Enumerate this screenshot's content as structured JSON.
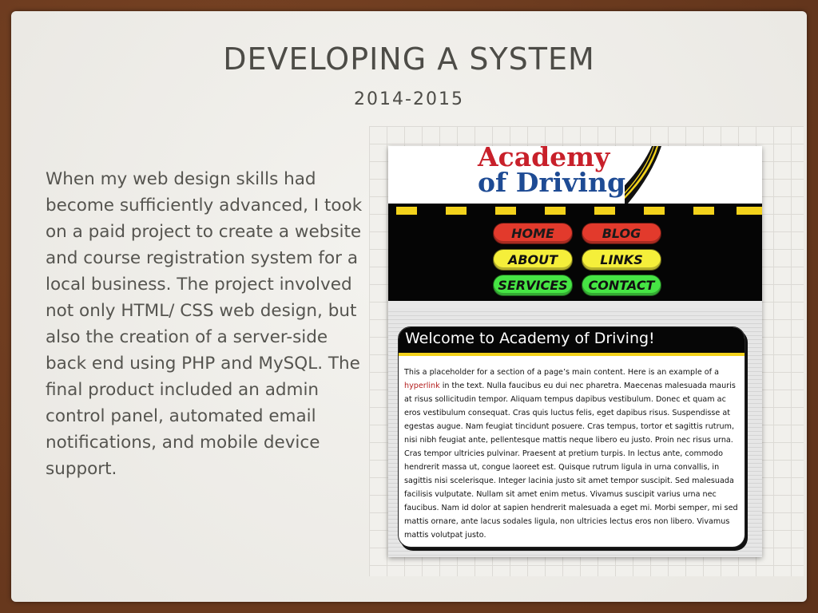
{
  "slide": {
    "title": "DEVELOPING A SYSTEM",
    "subtitle": "2014-2015",
    "body": "When my web design skills had become sufficiently advanced, I took on a paid project to create a website and course registration system for a local business. The project involved not only HTML/ CSS web design, but also the creation of a server-side back end using PHP and MySQL. The final product included an admin control panel, automated email notifications, and mobile device support."
  },
  "site": {
    "logo_line1": "Academy",
    "logo_line2": "of Driving",
    "nav": {
      "home": "HOME",
      "blog": "BLOG",
      "about": "ABOUT",
      "links": "LINKS",
      "services": "SERVICES",
      "contact": "CONTACT"
    },
    "welcome_title": "Welcome to Academy of Driving!",
    "content_before_link": "This a placeholder for a section of a page’s main content. Here is an example of a ",
    "link_text": "hyperlink",
    "content_after_link": " in the text. Nulla faucibus eu dui nec pharetra. Maecenas malesuada mauris at risus sollicitudin tempor. Aliquam tempus dapibus vestibulum. Donec et quam ac eros vestibulum consequat. Cras quis luctus felis, eget dapibus risus. Suspendisse at egestas augue. Nam feugiat tincidunt posuere. Cras tempus, tortor et sagittis rutrum, nisi nibh feugiat ante, pellentesque mattis neque libero eu justo. Proin nec risus urna. Cras tempor ultricies pulvinar. Praesent at pretium turpis. In lectus ante, commodo hendrerit massa ut, congue laoreet est. Quisque rutrum ligula in urna convallis, in sagittis nisi scelerisque. Integer lacinia justo sit amet tempor suscipit. Sed malesuada facilisis vulputate. Nullam sit amet enim metus. Vivamus suscipit varius urna nec faucibus. Nam id dolor at sapien hendrerit malesuada a eget mi. Morbi semper, mi sed mattis ornare, ante lacus sodales ligula, non ultricies lectus eros non libero. Vivamus mattis volutpat justo."
  },
  "colors": {
    "slide_text": "#4d4c47",
    "logo_red": "#c8202a",
    "logo_blue": "#1e4b94",
    "road_yellow": "#f3d21b",
    "nav_red": "#e23a2c",
    "nav_yellow": "#f5ef3a",
    "nav_green": "#46e544",
    "link_red": "#b31c1c"
  }
}
